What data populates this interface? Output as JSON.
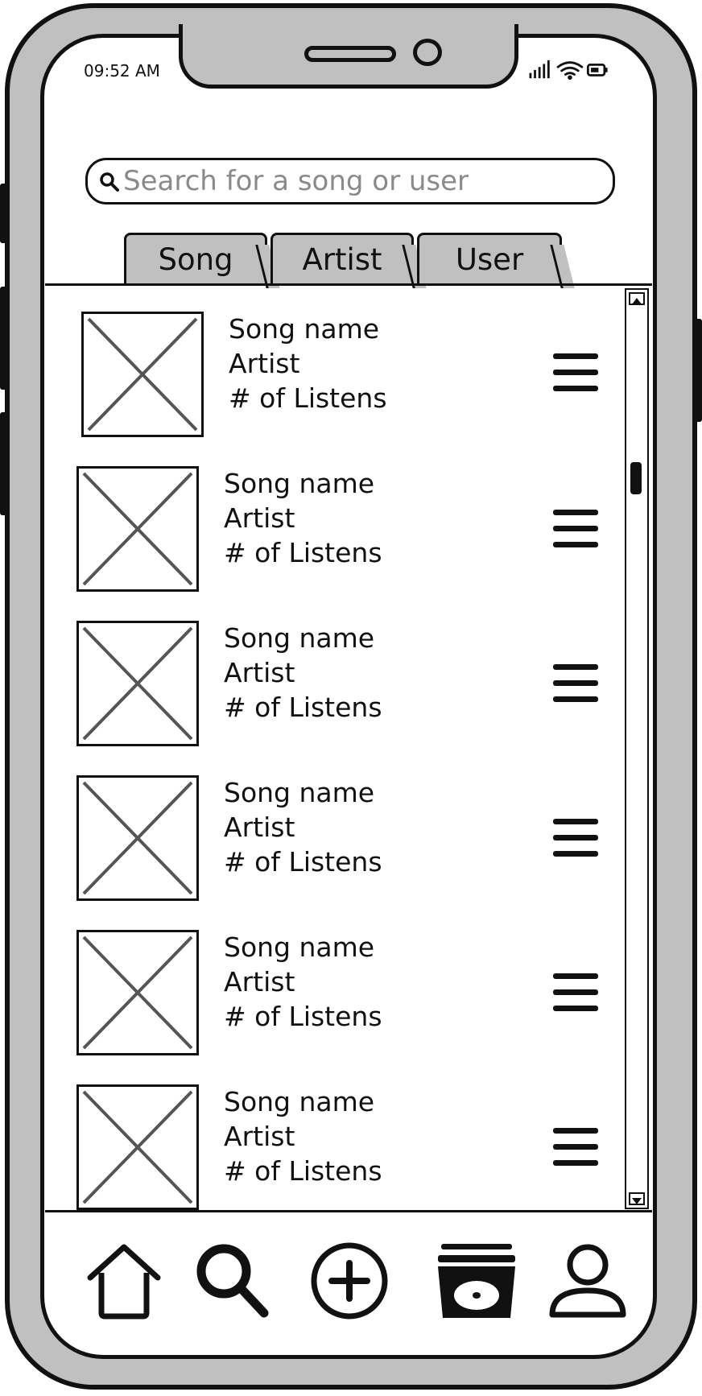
{
  "status_bar": {
    "time": "09:52 AM"
  },
  "search": {
    "placeholder": "Search for a song or user"
  },
  "tabs": [
    {
      "label": "Song"
    },
    {
      "label": "Artist"
    },
    {
      "label": "User"
    }
  ],
  "results": [
    {
      "title": "Song name",
      "artist": "Artist",
      "listens": "# of Listens"
    },
    {
      "title": "Song name",
      "artist": "Artist",
      "listens": "# of Listens"
    },
    {
      "title": "Song name",
      "artist": "Artist",
      "listens": "# of Listens"
    },
    {
      "title": "Song name",
      "artist": "Artist",
      "listens": "# of Listens"
    },
    {
      "title": "Song name",
      "artist": "Artist",
      "listens": "# of Listens"
    },
    {
      "title": "Song name",
      "artist": "Artist",
      "listens": "# of Listens"
    }
  ],
  "bottom_nav": [
    {
      "icon": "home-icon"
    },
    {
      "icon": "search-icon"
    },
    {
      "icon": "add-icon"
    },
    {
      "icon": "library-icon"
    },
    {
      "icon": "profile-icon"
    }
  ],
  "colors": {
    "frame": "#c0c0c0",
    "ink": "#111111",
    "placeholder": "#8a8a8a",
    "placeholder_image": "#555555"
  }
}
